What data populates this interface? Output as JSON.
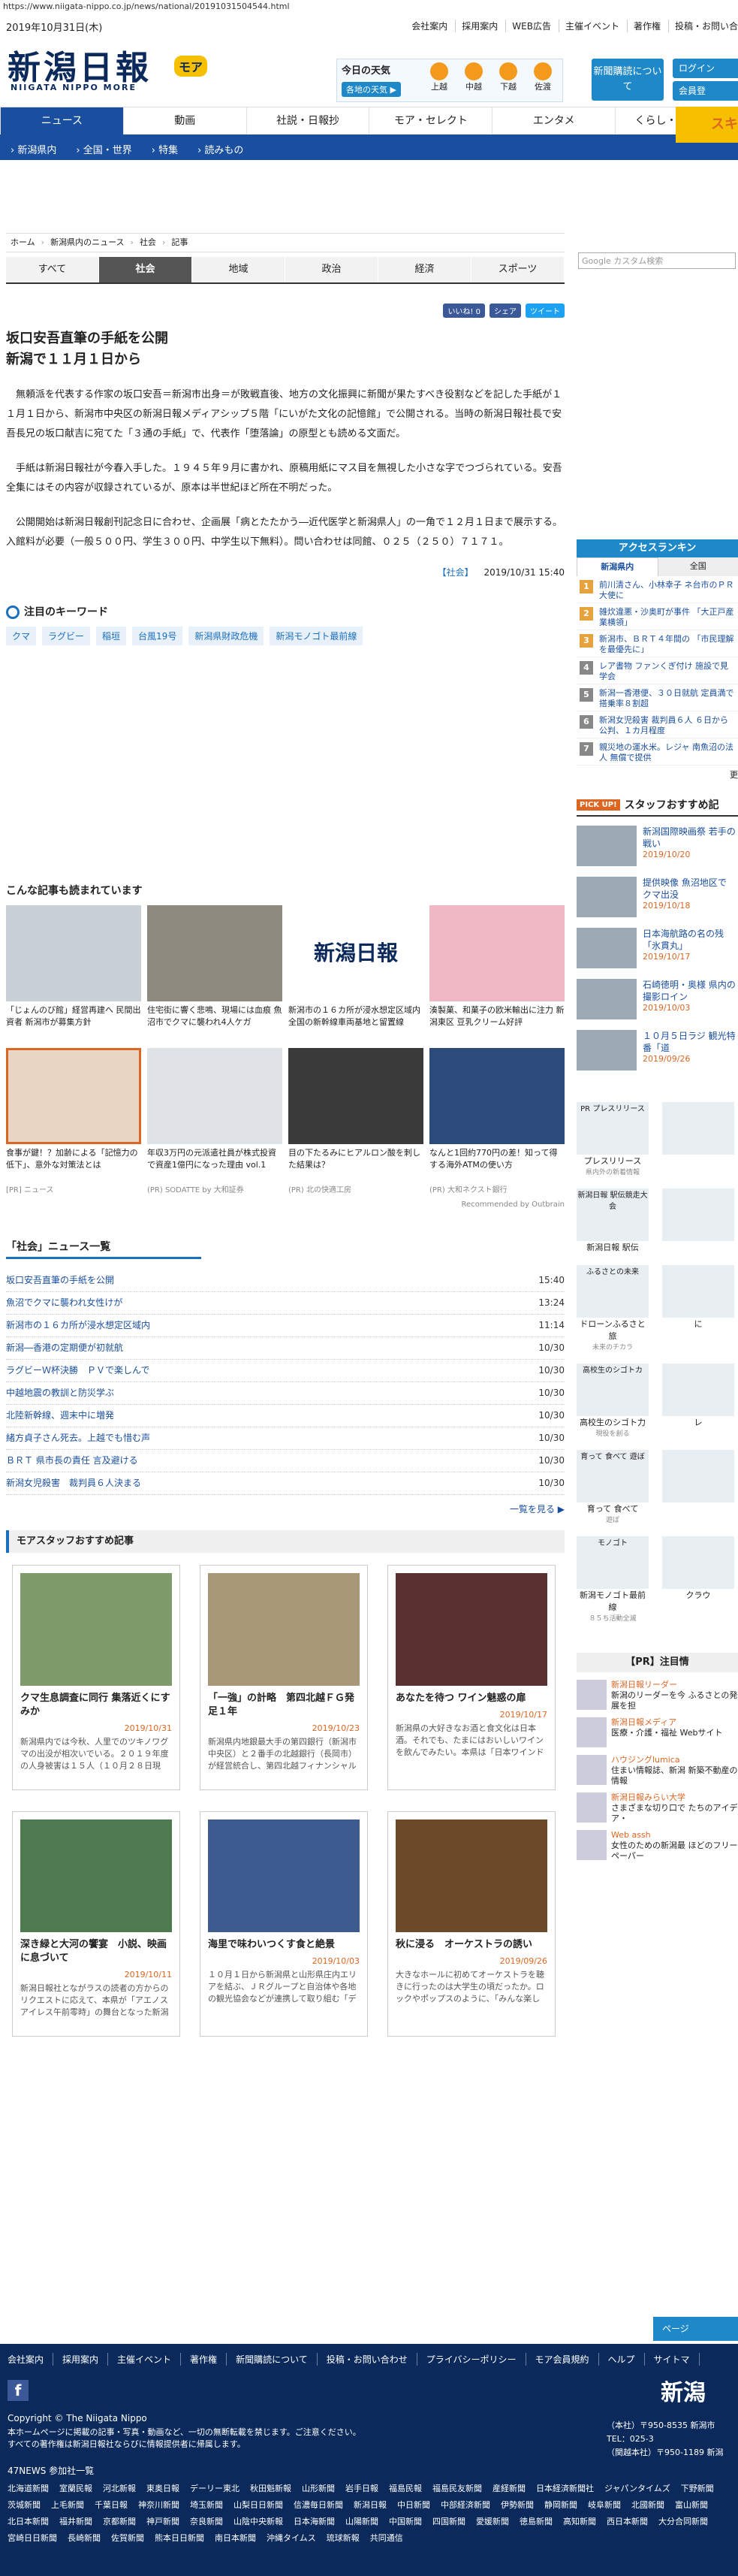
{
  "url": "https://www.niigata-nippo.co.jp/news/national/20191031504544.html",
  "header": {
    "date": "2019年10月31日(木)",
    "links": [
      "会社案内",
      "採用案内",
      "WEB広告",
      "主催イベント",
      "著作権",
      "投稿・お問い合"
    ],
    "logo": "新潟日報",
    "logo_moa": "モア",
    "logo_sub": "NIIGATA NIPPO MORE",
    "weather_title": "今日の天気",
    "weather_link": "各地の天気 ▶",
    "weather_cities": [
      "上越",
      "中越",
      "下越",
      "佐渡"
    ],
    "subscribe": "新聞購読について",
    "side_buttons": [
      "ログイン",
      "会員登"
    ]
  },
  "nav": {
    "items": [
      "ニュース",
      "動画",
      "社説・日報抄",
      "モア・セレクト",
      "エンタメ",
      "くらし・おでかけ"
    ],
    "active": 0,
    "sub": [
      "新潟県内",
      "全国・世界",
      "特集",
      "読みもの"
    ],
    "banner": "スキ"
  },
  "search_placeholder": "Google カスタム検索",
  "breadcrumb": [
    "ホーム",
    "新潟県内のニュース",
    "社会",
    "記事"
  ],
  "category_tabs": [
    "すべて",
    "社会",
    "地域",
    "政治",
    "経済",
    "スポーツ"
  ],
  "category_active": 1,
  "share": {
    "like": "いいね! 0",
    "share": "シェア",
    "tweet": "ツイート"
  },
  "article": {
    "title_1": "坂口安吾直筆の手紙を公開",
    "title_2": "新潟で１１月１日から",
    "p1": "無頼派を代表する作家の坂口安吾＝新潟市出身＝が敗戦直後、地方の文化振興に新聞が果たすべき役割などを記した手紙が１１月１日から、新潟市中央区の新潟日報メディアシップ５階「にいがた文化の記憶館」で公開される。当時の新潟日報社長で安吾長兄の坂口献吉に宛てた「３通の手紙」で、代表作「堕落論」の原型とも読める文面だ。",
    "p2": "手紙は新潟日報社が今春入手した。１９４５年９月に書かれ、原稿用紙にマス目を無視した小さな字でつづられている。安吾全集にはその内容が収録されているが、原本は半世紀ほど所在不明だった。",
    "p3": "公開開始は新潟日報創刊記念日に合わせ、企画展「病とたたかう―近代医学と新潟県人」の一角で１２月１日まで展示する。入館料が必要（一般５００円、学生３００円、中学生以下無料）。問い合わせは同館、０２５（２５０）７１７１。",
    "category": "【社会】",
    "datetime": "2019/10/31 15:40"
  },
  "keywords": {
    "title": "注目のキーワード",
    "items": [
      "クマ",
      "ラグビー",
      "稲垣",
      "台風19号",
      "新潟県財政危機",
      "新潟モノゴト最前線"
    ]
  },
  "recommend": {
    "title": "こんな記事も読まれています",
    "items": [
      {
        "t": "「じょんのび館」経営再建へ 民間出資者 新潟市が募集方針",
        "s": ""
      },
      {
        "t": "住宅街に響く悲鳴、現場には血痕 魚沼市でクマに襲われ4人ケガ",
        "s": ""
      },
      {
        "t": "新潟市の１６カ所が浸水想定区域内 全国の新幹線車両基地と留置線",
        "s": ""
      },
      {
        "t": "湊製菓、和菓子の欧米輸出に注力 新潟東区 豆乳クリーム好評",
        "s": ""
      },
      {
        "t": "食事が鍵！？加齢による「記憶力の低下」、意外な対策法とは",
        "s": "[PR] ニュース"
      },
      {
        "t": "年収3万円の元派遣社員が株式投資で資産1億円になった理由 vol.1",
        "s": "(PR) SODATTE by 大和証券"
      },
      {
        "t": "目の下たるみにヒアルロン酸を刺した結果は？",
        "s": "(PR) 北の快適工房"
      },
      {
        "t": "なんと1回約770円の差！知って得する海外ATMの使い方",
        "s": "(PR) 大和ネクスト銀行"
      }
    ],
    "outbrain": "Recommended by Outbrain"
  },
  "social_list": {
    "title": "「社会」ニュース一覧",
    "rows": [
      {
        "t": "坂口安吾直筆の手紙を公開",
        "d": "15:40"
      },
      {
        "t": "魚沼でクマに襲われ女性けが",
        "d": "13:24"
      },
      {
        "t": "新潟市の１６カ所が浸水想定区域内",
        "d": "11:14"
      },
      {
        "t": "新潟―香港の定期便が初就航",
        "d": "10/30"
      },
      {
        "t": "ラグビーＷ杯決勝　ＰＶで楽しんで",
        "d": "10/30"
      },
      {
        "t": "中越地震の教訓と防災学ぶ",
        "d": "10/30"
      },
      {
        "t": "北陸新幹線、週末中に増発",
        "d": "10/30"
      },
      {
        "t": "緒方貞子さん死去。上越でも惜む声",
        "d": "10/30"
      },
      {
        "t": "ＢＲＴ 県市長の責任 言及避ける",
        "d": "10/30"
      },
      {
        "t": "新潟女児殺害　裁判員６人決まる",
        "d": "10/30"
      }
    ],
    "more": "一覧を見る ▶"
  },
  "staff": {
    "title": "モアスタッフおすすめ記事",
    "items": [
      {
        "t": "クマ生息調査に同行 集落近くにすみか",
        "d": "2019/10/31",
        "x": "新潟県内では今秋、人里でのツキノワグマの出没が相次いでいる。２０１９年度の人身被害は１５人（１０月２８日現在）に上り..."
      },
      {
        "t": "「一強」の計略　第四北越ＦＧ発足１年",
        "d": "2019/10/23",
        "x": "新潟県内地銀最大手の第四銀行（新潟市中央区）と２番手の北越銀行（長岡市）が経営統合し、第四北越フィナンシャルグループ..."
      },
      {
        "t": "あなたを待つ ワイン魅惑の扉",
        "d": "2019/10/17",
        "x": "新潟県の大好きなお酒と食文化は日本酒。それでも、たまにはおいしいワインを飲んでみたい。本県は「日本ワインドドウの父」と..."
      },
      {
        "t": "深き緑と大河の饗宴　小説、映画に息づいて",
        "d": "2019/10/11",
        "x": "新潟日報社とながラスの読者の方からのリクエストに応えて、本県が「アエノスアイレス午前零時」の舞台となった新潟東東蒲原郡阿..."
      },
      {
        "t": "海里で味わいつくす食と絶景",
        "d": "2019/10/03",
        "x": "１０月１日から新潟県と山形県庄内エリアを結ぶ、ＪＲグループと自治体や各地の観光協会などが連携して取り組む「デスティネ..."
      },
      {
        "t": "秋に浸る　オーケストラの誘い",
        "d": "2019/09/26",
        "x": "大きなホールに初めてオーケストラを聴きに行ったのは大学生の頃だったか。ロックやポップスのように、「みんな楽しんでるー？..."
      }
    ]
  },
  "ranking": {
    "title": "アクセスランキン",
    "tabs": [
      "新潟県内",
      "全国"
    ],
    "items": [
      "前川清さん、小林幸子 ネ台市のＰＲ大使に",
      "雑炊違悪・沙奥町が事件 「大正戸産業横領」",
      "新潟市、ＢＲＴ４年間の 「市民理解を最優先に」",
      "レア書物 ファンくぎ付け 施設で見学会",
      "新潟一香港便、３０日就航 定員満で搭乗率８割超",
      "新潟女児殺害 裁判員６人 ６日から公判、１カ月程度",
      "親災地の運水米。レジャ 南魚沼の法人 無償で提供"
    ],
    "rank_colors": [
      "#e6a23c",
      "#e6a23c",
      "#e6a23c",
      "#888888",
      "#888888",
      "#888888",
      "#888888"
    ],
    "more": "更"
  },
  "pickup": {
    "tag": "PICK UP!",
    "title": "スタッフおすすめ記",
    "items": [
      {
        "t": "新潟国際映画祭 若手の戦い",
        "d": "2019/10/20"
      },
      {
        "t": "提供映像 魚沼地区で クマ出没",
        "d": "2019/10/18"
      },
      {
        "t": "日本海航路の名の残「氷貫丸」",
        "d": "2019/10/17"
      },
      {
        "t": "石崎徳明・奥様 県内の撮影ロイン",
        "d": "2019/10/03"
      },
      {
        "t": "１０月５日ラジ 観光特番「道",
        "d": "2019/09/26"
      }
    ]
  },
  "promos": [
    {
      "b": "PR プレスリリース",
      "cap": "プレスリリース",
      "sm": "県内外の新着情報"
    },
    {
      "b": "",
      "cap": "",
      "sm": ""
    },
    {
      "b": "新潟日報 駅伝競走大会",
      "cap": "新潟日報 駅伝",
      "sm": ""
    },
    {
      "b": "",
      "cap": "",
      "sm": ""
    },
    {
      "b": "ふるさとの未来",
      "cap": "ドローンふるさと旅",
      "sm": "未来のチカラ"
    },
    {
      "b": "",
      "cap": "に",
      "sm": ""
    },
    {
      "b": "高校生のシゴトカ",
      "cap": "高校生のシゴト力",
      "sm": "現役を創る"
    },
    {
      "b": "",
      "cap": "レ",
      "sm": ""
    },
    {
      "b": "育って 食べて 遊ぼ",
      "cap": "育って 食べて",
      "sm": "遊ぼ"
    },
    {
      "b": "",
      "cap": "",
      "sm": ""
    },
    {
      "b": "モノゴト",
      "cap": "新潟モノゴト最前線",
      "sm": "８５ち活動全滅"
    },
    {
      "b": "",
      "cap": "クラウ",
      "sm": ""
    }
  ],
  "ads": {
    "title": "【PR】注目情",
    "items": [
      {
        "h": "新潟日報リーダー",
        "x": "新潟のリーダーを今 ふるさとの発展を担"
      },
      {
        "h": "新潟日報メディア",
        "x": "医療・介護・福祉 Webサイト"
      },
      {
        "h": "ハウジングlumica",
        "x": "住まい情報誌、新潟 新築不動産の情報"
      },
      {
        "h": "新潟日報みらい大学",
        "x": "さまざまな切り口で たちのアイデア・"
      },
      {
        "h": "Web assh",
        "x": "女性のための新潟最 ほどのフリーペーパー"
      }
    ]
  },
  "top_button": "ページ",
  "footer": {
    "links": [
      "会社案内",
      "採用案内",
      "主催イベント",
      "著作権",
      "新聞購読について",
      "投稿・お問い合わせ",
      "プライバシーポリシー",
      "モア会員規約",
      "ヘルプ",
      "サイトマ"
    ],
    "logo": "新潟",
    "copyright": "Copyright © The Niigata Nippo",
    "note1": "本ホームページに掲載の記事・写真・動画など、一切の無断転載を禁じます。ご注意ください。",
    "note2": "すべての著作権は新潟日報社ならびに情報提供者に帰属します。",
    "addr1": "（本社）〒950-8535 新潟市",
    "addr2": "TEL：025-3",
    "addr3": "（関越本社）〒950-1189 新潟",
    "n47": "47NEWS 参加社一覧",
    "papers": [
      "北海道新聞",
      "室蘭民報",
      "河北新報",
      "東奥日報",
      "デーリー東北",
      "秋田魁新報",
      "山形新聞",
      "岩手日報",
      "福島民報",
      "福島民友新聞",
      "産経新聞",
      "日本経済新聞社",
      "ジャパンタイムズ",
      "下野新聞",
      "茨城新聞",
      "上毛新聞",
      "千葉日報",
      "神奈川新聞",
      "埼玉新聞",
      "山梨日日新聞",
      "信濃毎日新聞",
      "新潟日報",
      "中日新聞",
      "中部経済新聞",
      "伊勢新聞",
      "静岡新聞",
      "岐阜新聞",
      "北國新聞",
      "富山新聞",
      "北日本新聞",
      "福井新聞",
      "京都新聞",
      "神戸新聞",
      "奈良新聞",
      "山陰中央新報",
      "日本海新聞",
      "山陽新聞",
      "中国新聞",
      "四国新聞",
      "愛媛新聞",
      "徳島新聞",
      "高知新聞",
      "西日本新聞",
      "大分合同新聞",
      "宮崎日日新聞",
      "長崎新聞",
      "佐賀新聞",
      "熊本日日新聞",
      "南日本新聞",
      "沖縄タイムス",
      "琉球新報",
      "共同通信"
    ]
  }
}
